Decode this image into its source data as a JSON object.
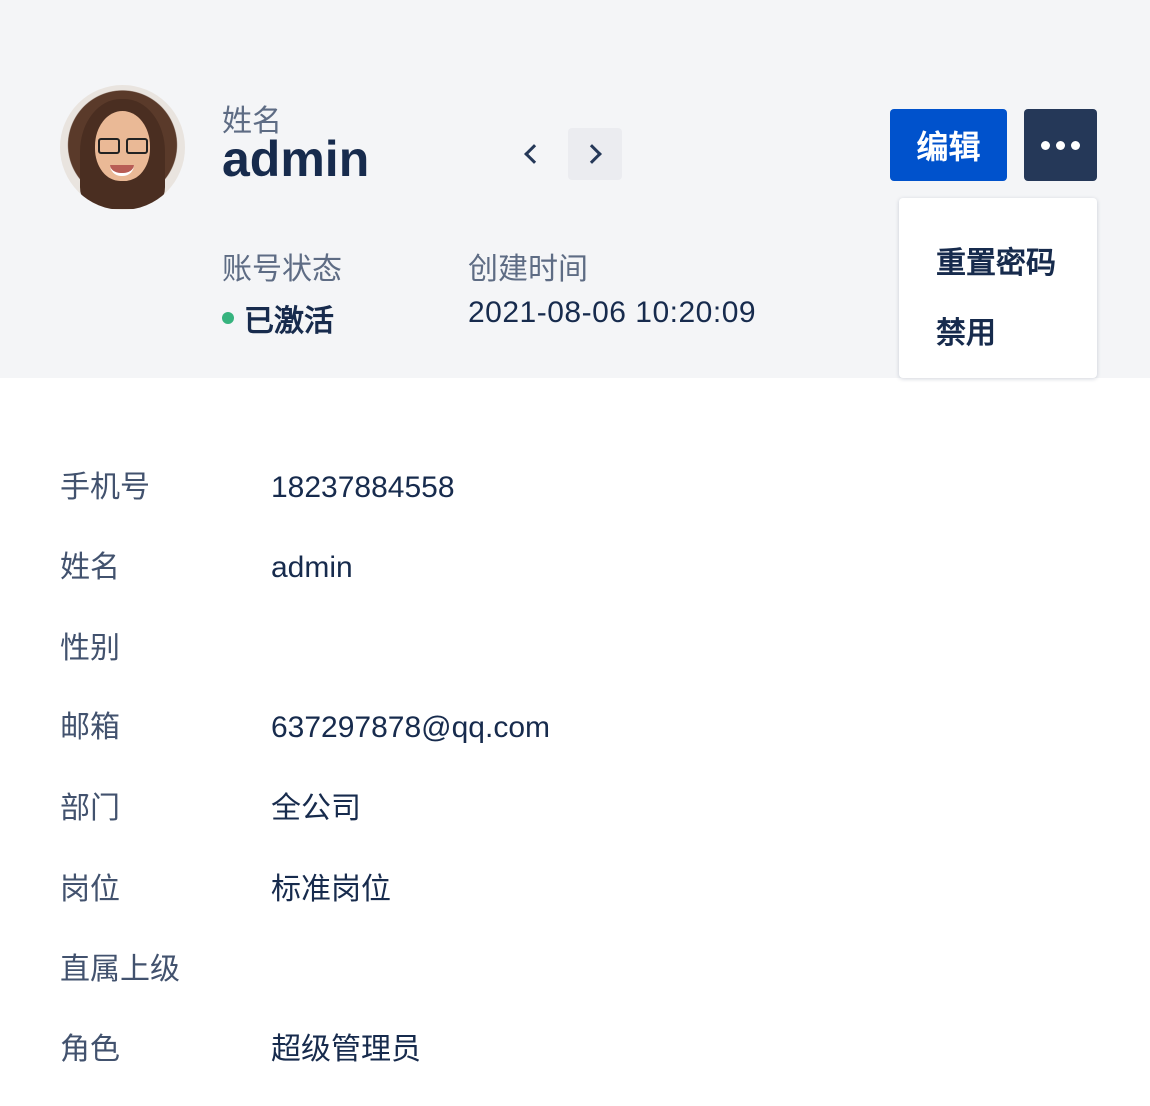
{
  "profile": {
    "name_label": "姓名",
    "name": "admin",
    "status_label": "账号状态",
    "status": "已激活",
    "status_color": "#36b37e",
    "created_label": "创建时间",
    "created_time": "2021-08-06   10:20:09"
  },
  "actions": {
    "edit_label": "编辑",
    "more_icon": "ellipsis-icon",
    "accent_color": "#0052cc"
  },
  "menu": {
    "items": [
      {
        "label": "重置密码"
      },
      {
        "label": "禁用"
      }
    ]
  },
  "details": [
    {
      "label": "手机号",
      "value": "18237884558"
    },
    {
      "label": "姓名",
      "value": "admin"
    },
    {
      "label": "性别",
      "value": ""
    },
    {
      "label": "邮箱",
      "value": "637297878@qq.com"
    },
    {
      "label": "部门",
      "value": "全公司"
    },
    {
      "label": "岗位",
      "value": "标准岗位"
    },
    {
      "label": "直属上级",
      "value": ""
    },
    {
      "label": "角色",
      "value": "超级管理员"
    }
  ]
}
